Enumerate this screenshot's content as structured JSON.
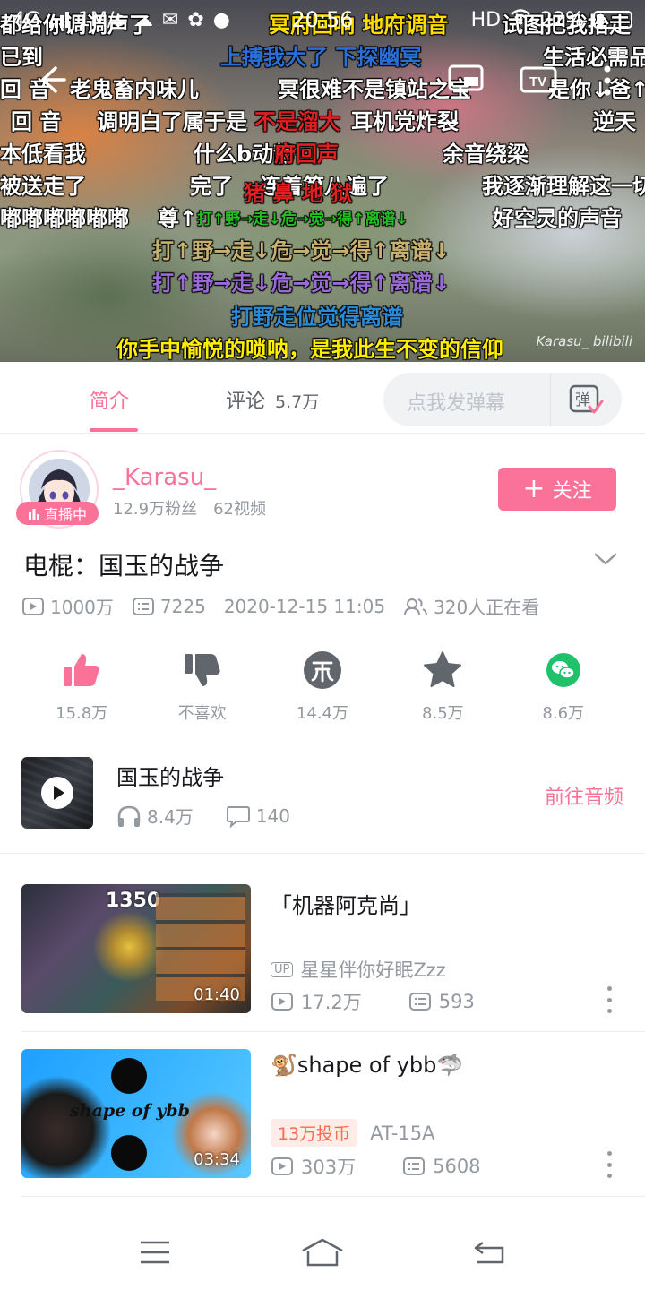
{
  "status_bar": {
    "network": "4G",
    "speed": "1M/s",
    "time": "20:56",
    "hd": "HD",
    "battery": "22%"
  },
  "video_player": {
    "watermark": "Karasu_ bilibili",
    "danmaku": [
      {
        "text": "都给你调调声了",
        "color": "#ffffff"
      },
      {
        "text": "冥府回响 地府调音",
        "color": "#ffdd00"
      },
      {
        "text": "试图把我抬走",
        "color": "#ffffff"
      },
      {
        "text": "已到",
        "color": "#ffffff"
      },
      {
        "text": "上搏我大了 下探幽冥",
        "color": "#2a6fd6"
      },
      {
        "text": "生活必需品",
        "color": "#ffffff"
      },
      {
        "text": "回 音",
        "color": "#ffffff"
      },
      {
        "text": "老鬼畜内味儿",
        "color": "#ffffff"
      },
      {
        "text": "冥很难不是镇站之宝",
        "color": "#ffffff"
      },
      {
        "text": "是你↓爸↑",
        "color": "#ffffff"
      },
      {
        "text": "回 音",
        "color": "#ffffff"
      },
      {
        "text": "调明白了属于是",
        "color": "#ffffff"
      },
      {
        "text": "不是溜大",
        "color": "#e02020"
      },
      {
        "text": "耳机党炸裂",
        "color": "#ffffff"
      },
      {
        "text": "逆天",
        "color": "#ffffff"
      },
      {
        "text": "本低看我",
        "color": "#ffffff"
      },
      {
        "text": "什么b动静",
        "color": "#ffffff"
      },
      {
        "text": "府回声",
        "color": "#e02020"
      },
      {
        "text": "余音绕梁",
        "color": "#ffffff"
      },
      {
        "text": "被送走了",
        "color": "#ffffff"
      },
      {
        "text": "完了",
        "color": "#ffffff"
      },
      {
        "text": "连着第八遍了",
        "color": "#ffffff"
      },
      {
        "text": "我逐渐理解这一切",
        "color": "#ffffff"
      },
      {
        "text": "猪 鼻 地 狱",
        "color": "#e02020"
      },
      {
        "text": "嘟嘟嘟嘟嘟嘟",
        "color": "#ffffff"
      },
      {
        "text": "尊↑",
        "color": "#ffffff"
      },
      {
        "text": "打↑野→走↓危→觉→得↑离谱↓",
        "color": "#20c020"
      },
      {
        "text": "好空灵的声音",
        "color": "#ffffff"
      },
      {
        "text": "打↑野→走↓危→觉→得↑离谱↓",
        "color": "#c8b070"
      },
      {
        "text": "打↑野→走↓危→觉→得↑离谱↓",
        "color": "#9a6ad6"
      },
      {
        "text": "打野走位觉得离谱",
        "color": "#2a8ad6"
      },
      {
        "text": "你手中愉悦的唢呐，是我此生不变的信仰",
        "color": "#ffee00"
      }
    ]
  },
  "tabs": {
    "intro": "简介",
    "comments": "评论",
    "comments_count": "5.7万",
    "danmu_placeholder": "点我发弹幕",
    "danmu_icon_text": "弹"
  },
  "uploader": {
    "live_badge": "直播中",
    "name": "_Karasu_",
    "fans": "12.9万粉丝",
    "videos": "62视频",
    "follow_label": "关注"
  },
  "video": {
    "title": "电棍：国玉的战争",
    "views": "1000万",
    "danmaku_count": "7225",
    "date": "2020-12-15 11:05",
    "watching": "320人正在看"
  },
  "actions": [
    {
      "label": "15.8万",
      "icon": "thumb-up-icon",
      "color": "#fb7299"
    },
    {
      "label": "不喜欢",
      "icon": "thumb-down-icon",
      "color": "#61666d"
    },
    {
      "label": "14.4万",
      "icon": "coin-icon",
      "color": "#61666d"
    },
    {
      "label": "8.5万",
      "icon": "star-icon",
      "color": "#61666d"
    },
    {
      "label": "8.6万",
      "icon": "wechat-icon",
      "color": "#1fc16b"
    }
  ],
  "audio": {
    "title": "国玉的战争",
    "plays": "8.4万",
    "comments": "140",
    "link": "前往音频"
  },
  "recommendations": [
    {
      "title": "「机器阿克尚」",
      "duration": "01:40",
      "up_tag": "UP",
      "uploader": "星星伴你好眠Zzz",
      "views": "17.2万",
      "danmaku": "593",
      "thumb_text": "1350"
    },
    {
      "title": "🐒shape of ybb🦈",
      "duration": "03:34",
      "coin_tag": "13万投币",
      "uploader": "AT-15A",
      "views": "303万",
      "danmaku": "5608",
      "thumb_text": "shape of ybb"
    }
  ],
  "colors": {
    "accent": "#fb7299",
    "text": "#18191c",
    "secondary": "#9499a0"
  }
}
